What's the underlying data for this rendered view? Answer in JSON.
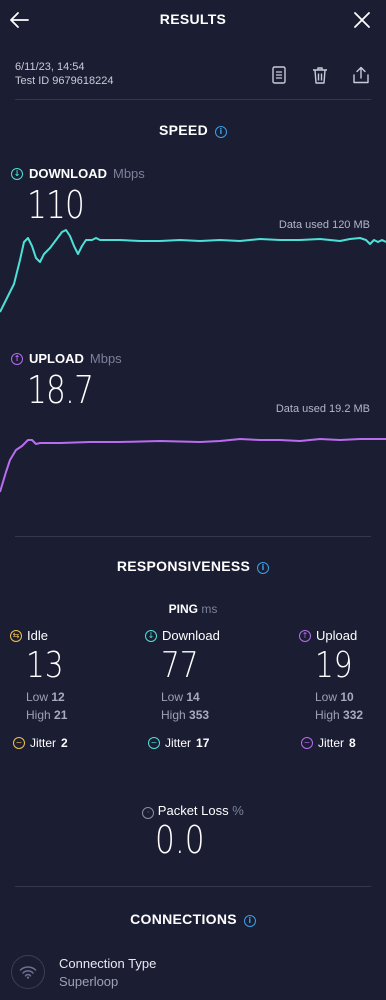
{
  "header": {
    "title": "RESULTS",
    "back_icon": "arrow-left-icon",
    "close_icon": "close-icon"
  },
  "meta": {
    "datetime": "6/11/23, 14:54",
    "test_id": "Test ID 9679618224"
  },
  "toolbar": {
    "icons": [
      "document-icon",
      "trash-icon",
      "share-icon"
    ]
  },
  "speed": {
    "title": "SPEED",
    "download": {
      "label": "DOWNLOAD",
      "unit": "Mbps",
      "value": "110",
      "data_used": "Data used 120 MB",
      "color": "#4ee0d6"
    },
    "upload": {
      "label": "UPLOAD",
      "unit": "Mbps",
      "value": "18.7",
      "data_used": "Data used 19.2 MB",
      "color": "#b96cf0"
    }
  },
  "responsiveness": {
    "title": "RESPONSIVENESS",
    "ping_label": "PING",
    "ping_unit": "ms",
    "idle": {
      "label": "Idle",
      "value": "13",
      "low_label": "Low",
      "low": "12",
      "high_label": "High",
      "high": "21",
      "jitter_label": "Jitter",
      "jitter": "2",
      "color": "#f2c14e"
    },
    "download": {
      "label": "Download",
      "value": "77",
      "low_label": "Low",
      "low": "14",
      "high_label": "High",
      "high": "353",
      "jitter_label": "Jitter",
      "jitter": "17",
      "color": "#4ee0d6"
    },
    "upload": {
      "label": "Upload",
      "value": "19",
      "low_label": "Low",
      "low": "10",
      "high_label": "High",
      "high": "332",
      "jitter_label": "Jitter",
      "jitter": "8",
      "color": "#b96cf0"
    },
    "packet_loss": {
      "label": "Packet Loss",
      "unit": "%",
      "value": "0.0"
    }
  },
  "connections": {
    "title": "CONNECTIONS",
    "type_label": "Connection Type",
    "provider": "Superloop",
    "icon": "wifi-icon"
  }
}
